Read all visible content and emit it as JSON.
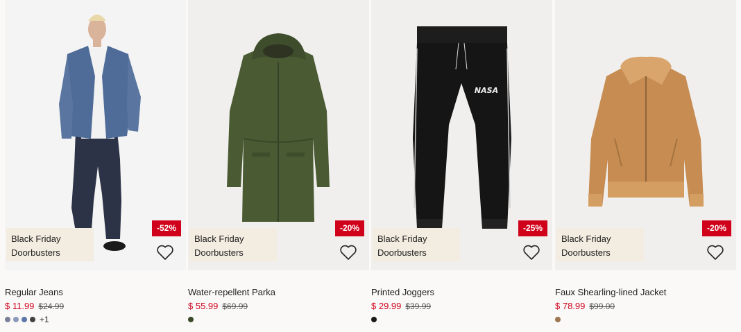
{
  "products": [
    {
      "name": "Regular Jeans",
      "price": "$ 11.99",
      "old_price": "$24.99",
      "discount": "-52%",
      "promo_line1": "Black Friday",
      "promo_line2": "Doorbusters",
      "image": "model-denim-jacket-jeans",
      "swatches": [
        "#7a7f98",
        "#8c99b9",
        "#5d76a8",
        "#414141"
      ],
      "more_colors": "+1",
      "media_bg": "#f4f4f4"
    },
    {
      "name": "Water-repellent Parka",
      "price": "$ 55.99",
      "old_price": "$69.99",
      "discount": "-20%",
      "promo_line1": "Black Friday",
      "promo_line2": "Doorbusters",
      "image": "green-parka",
      "swatches": [
        "#3a4a2a"
      ],
      "more_colors": "",
      "media_bg": "#efeeec"
    },
    {
      "name": "Printed Joggers",
      "price": "$ 29.99",
      "old_price": "$39.99",
      "discount": "-25%",
      "promo_line1": "Black Friday",
      "promo_line2": "Doorbusters",
      "image": "black-nasa-joggers",
      "print_text": "NASA",
      "swatches": [
        "#1a1a1a"
      ],
      "more_colors": "",
      "media_bg": "#efeeec"
    },
    {
      "name": "Faux Shearling-lined Jacket",
      "price": "$ 78.99",
      "old_price": "$99.00",
      "discount": "-20%",
      "promo_line1": "Black Friday",
      "promo_line2": "Doorbusters",
      "image": "tan-shearling-jacket",
      "swatches": [
        "#9c7651"
      ],
      "more_colors": "",
      "media_bg": "#efeeec"
    }
  ],
  "icons": {
    "favorite": "heart-icon"
  },
  "colors": {
    "sale_red": "#d0021b",
    "promo_bg": "#f3ece0"
  }
}
